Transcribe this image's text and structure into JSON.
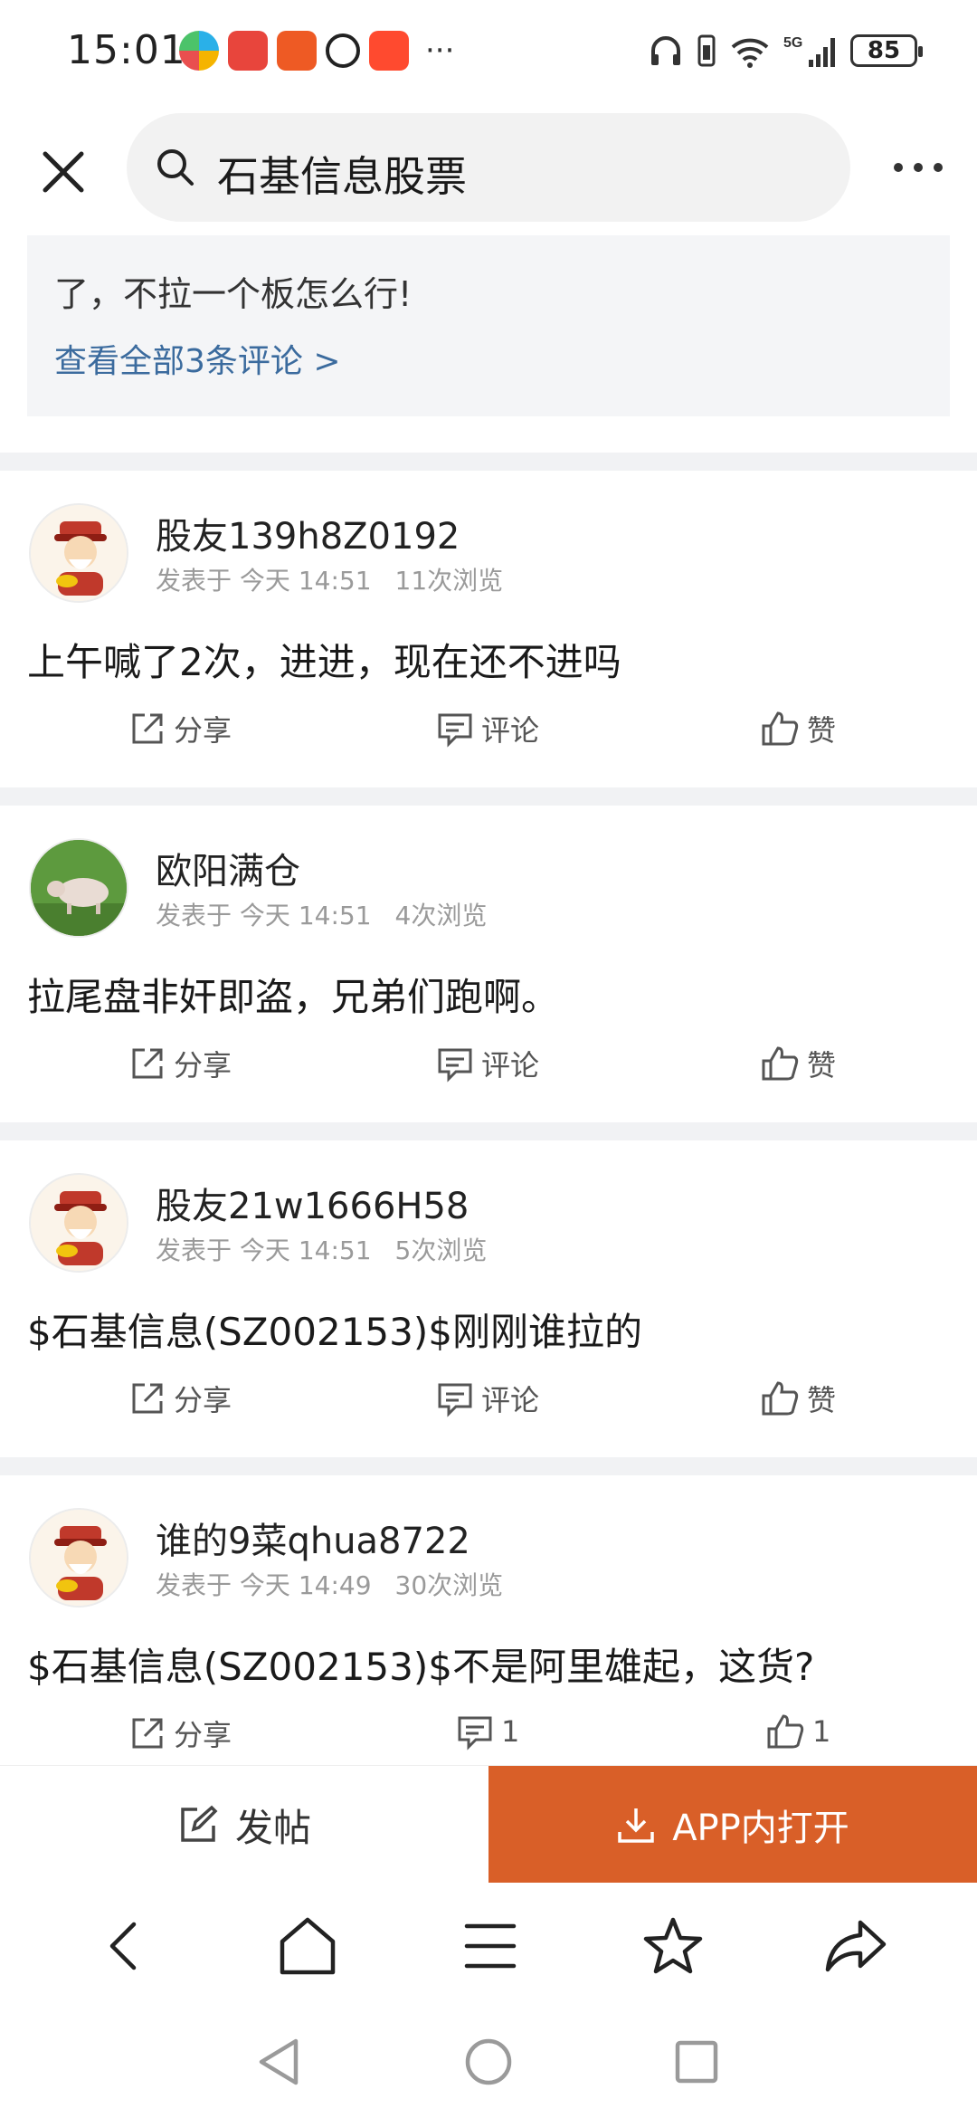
{
  "status_bar": {
    "time": "15:01",
    "battery": "85",
    "network": "5G"
  },
  "search": {
    "query": "石基信息股票"
  },
  "comment_preview": {
    "line": "了，不拉一个板怎么行!",
    "view_all_link": "查看全部3条评论 >"
  },
  "posts": [
    {
      "username": "股友139h8Z0192",
      "posted_prefix": "发表于",
      "posted_time": "今天 14:51",
      "views": "11次浏览",
      "text": "上午喊了2次，进进，现在还不进吗",
      "share_label": "分享",
      "comment_label": "评论",
      "like_label": "赞"
    },
    {
      "username": "欧阳满仓",
      "posted_prefix": "发表于",
      "posted_time": "今天 14:51",
      "views": "4次浏览",
      "text": "拉尾盘非奸即盗，兄弟们跑啊。",
      "share_label": "分享",
      "comment_label": "评论",
      "like_label": "赞"
    },
    {
      "username": "股友21w1666H58",
      "posted_prefix": "发表于",
      "posted_time": "今天 14:51",
      "views": "5次浏览",
      "text": "$石基信息(SZ002153)$刚刚谁拉的",
      "share_label": "分享",
      "comment_label": "评论",
      "like_label": "赞"
    },
    {
      "username": "谁的9菜qhua8722",
      "posted_prefix": "发表于",
      "posted_time": "今天 14:49",
      "views": "30次浏览",
      "text": "$石基信息(SZ002153)$不是阿里雄起，这货?",
      "share_label": "分享",
      "comment_label": "1",
      "like_label": "1"
    }
  ],
  "bottom_bar": {
    "post_label": "发帖",
    "open_app_label": "APP内打开"
  },
  "colors": {
    "accent": "#d95f28",
    "link": "#3b6b9e",
    "meta": "#9a9a9a"
  },
  "icons": {
    "browser_nav": [
      "back-icon",
      "home-icon",
      "menu-icon",
      "star-icon",
      "share-icon"
    ],
    "system_nav": [
      "back-triangle-icon",
      "home-circle-icon",
      "recents-square-icon"
    ]
  }
}
